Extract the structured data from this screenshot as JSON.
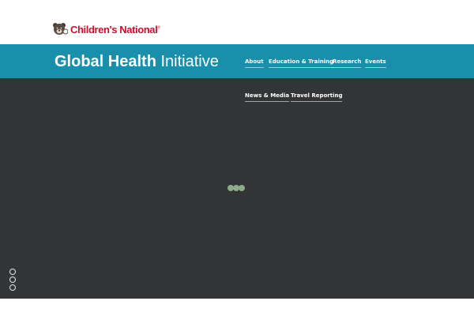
{
  "brand": {
    "logo_text": "Children's National",
    "logo_trademark": "®",
    "logo_icon": "teddy-bear-icon",
    "logo_color": "#c8102e"
  },
  "header": {
    "title_bold": "Global Health",
    "title_light": "Initiative",
    "bar_color": "#1a8fab"
  },
  "nav": {
    "items": [
      {
        "label": "About"
      },
      {
        "label": "Education & Training"
      },
      {
        "label": "Research"
      },
      {
        "label": "Events"
      },
      {
        "label": "News & Media"
      },
      {
        "label": "Travel Reporting"
      }
    ]
  },
  "hero": {
    "background_color": "#333435",
    "loader_icon": "loading-dots-icon",
    "slide_count": 3
  }
}
